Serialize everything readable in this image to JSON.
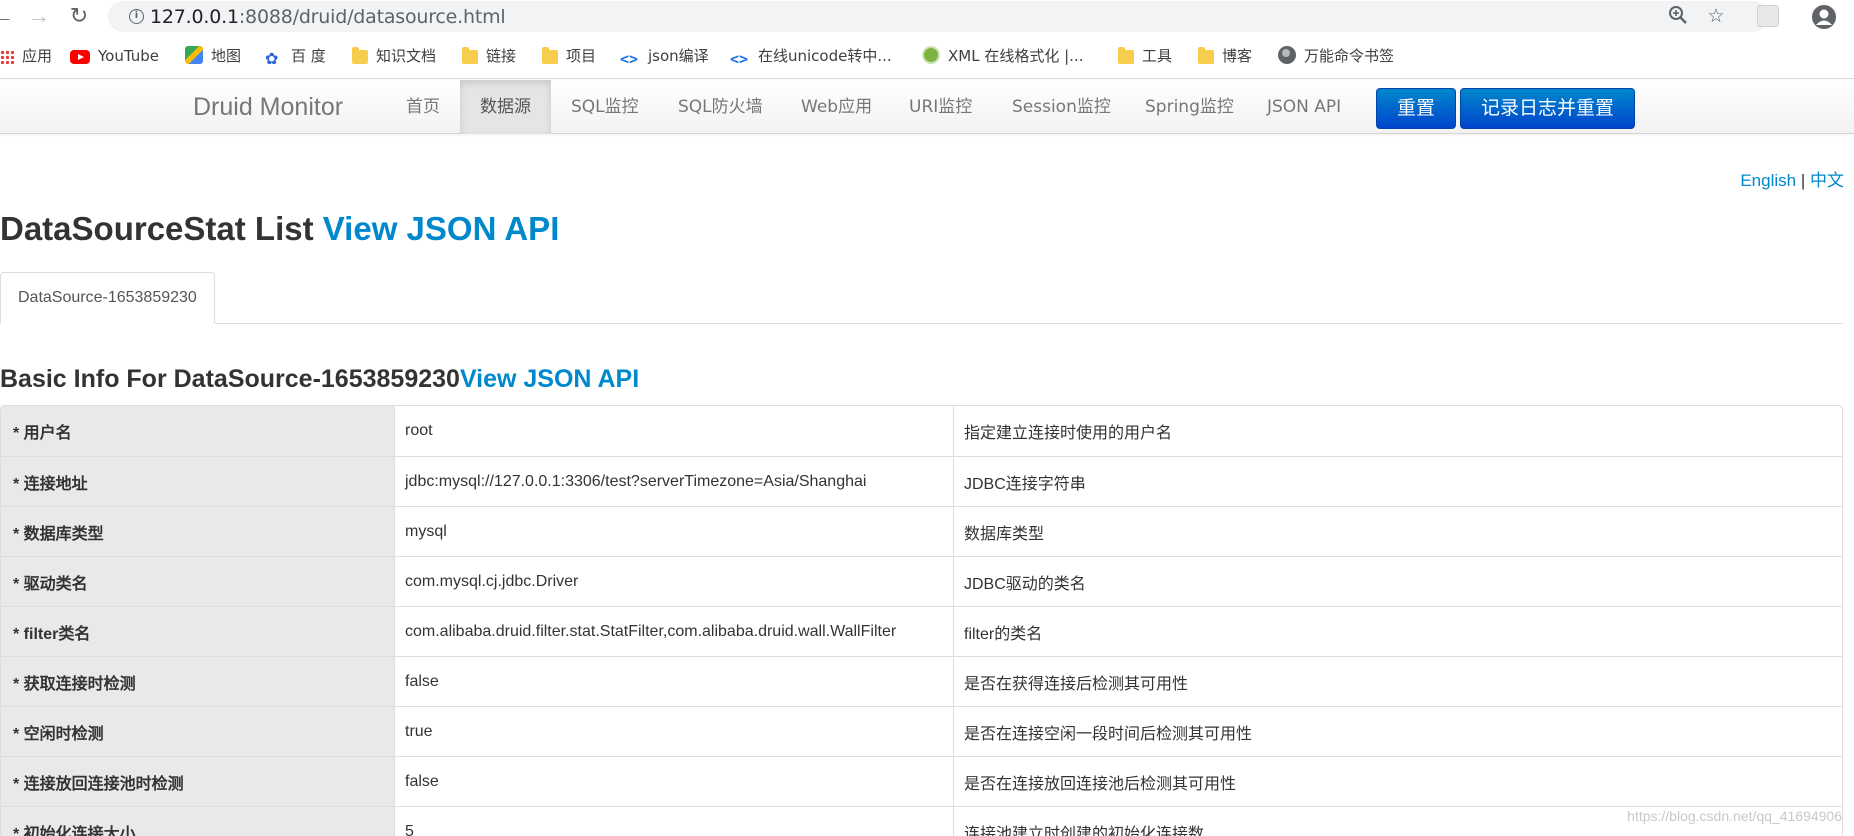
{
  "browser": {
    "url_host": "127.0.0.1",
    "url_path": ":8088/druid/datasource.html",
    "bookmarks": [
      {
        "label": "应用",
        "icon": "apps-grid-icon"
      },
      {
        "label": "YouTube",
        "icon": "youtube-icon"
      },
      {
        "label": "地图",
        "icon": "maps-icon"
      },
      {
        "label": "百 度",
        "icon": "baidu-paw-icon"
      },
      {
        "label": "知识文档",
        "icon": "folder-icon"
      },
      {
        "label": "链接",
        "icon": "folder-icon"
      },
      {
        "label": "项目",
        "icon": "folder-icon"
      },
      {
        "label": "json编译",
        "icon": "code-icon"
      },
      {
        "label": "在线unicode转中...",
        "icon": "code-icon"
      },
      {
        "label": "XML 在线格式化 |...",
        "icon": "xml-icon"
      },
      {
        "label": "工具",
        "icon": "folder-icon"
      },
      {
        "label": "博客",
        "icon": "folder-icon"
      },
      {
        "label": "万能命令书签",
        "icon": "globe-icon"
      }
    ]
  },
  "navbar": {
    "brand": "Druid Monitor",
    "items": [
      "首页",
      "数据源",
      "SQL监控",
      "SQL防火墙",
      "Web应用",
      "URI监控",
      "Session监控",
      "Spring监控",
      "JSON API"
    ],
    "active_index": 1,
    "reset_label": "重置",
    "log_reset_label": "记录日志并重置"
  },
  "lang": {
    "english": "English",
    "separator": "|",
    "chinese": "中文"
  },
  "page": {
    "title": "DataSourceStat List",
    "title_link": "View JSON API",
    "tab_label": "DataSource-1653859230",
    "section_title": "Basic Info For DataSource-1653859230",
    "section_link": "View JSON API"
  },
  "table": {
    "rows": [
      {
        "key": "* 用户名",
        "value": "root",
        "desc": "指定建立连接时使用的用户名"
      },
      {
        "key": "* 连接地址",
        "value": "jdbc:mysql://127.0.0.1:3306/test?serverTimezone=Asia/Shanghai",
        "desc": "JDBC连接字符串"
      },
      {
        "key": "* 数据库类型",
        "value": "mysql",
        "desc": "数据库类型"
      },
      {
        "key": "* 驱动类名",
        "value": "com.mysql.cj.jdbc.Driver",
        "desc": "JDBC驱动的类名"
      },
      {
        "key": "* filter类名",
        "value": "com.alibaba.druid.filter.stat.StatFilter,com.alibaba.druid.wall.WallFilter",
        "desc": "filter的类名"
      },
      {
        "key": "* 获取连接时检测",
        "value": "false",
        "desc": "是否在获得连接后检测其可用性"
      },
      {
        "key": "* 空闲时检测",
        "value": "true",
        "desc": "是否在连接空闲一段时间后检测其可用性"
      },
      {
        "key": "* 连接放回连接池时检测",
        "value": "false",
        "desc": "是否在连接放回连接池后检测其可用性"
      },
      {
        "key": "* 初始化连接大小",
        "value": "5",
        "desc": "连接池建立时创建的初始化连接数"
      }
    ]
  },
  "watermark": "https://blog.csdn.net/qq_41694906"
}
